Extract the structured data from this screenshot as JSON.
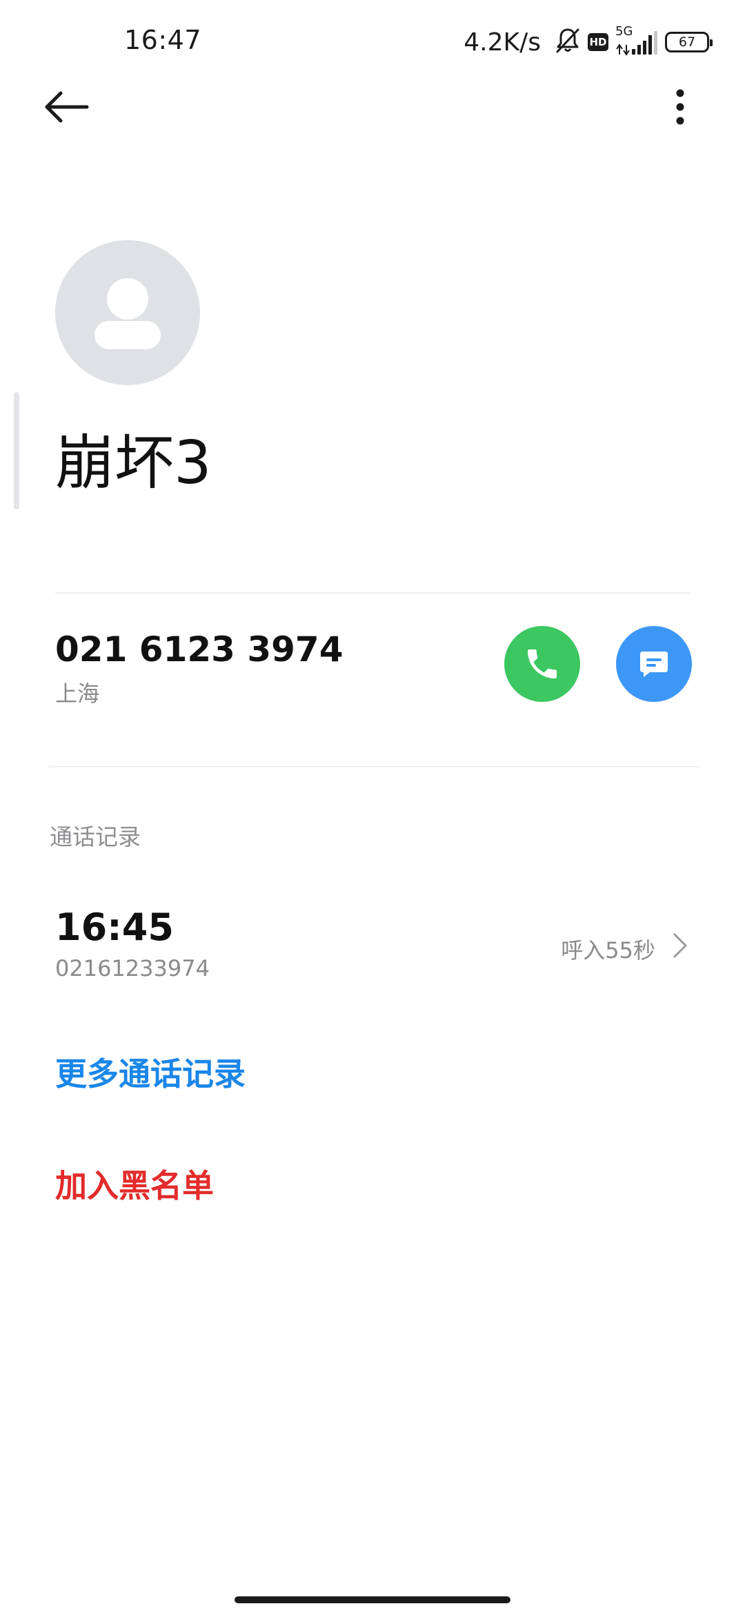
{
  "status_bar": {
    "time": "16:47",
    "net_speed": "4.2K/s",
    "hd_label": "HD",
    "network_label": "5G",
    "battery_level": "67"
  },
  "contact": {
    "name": "崩坏3",
    "phone_number": "021 6123 3974",
    "location": "上海"
  },
  "call_log": {
    "section_title": "通话记录",
    "items": [
      {
        "time": "16:45",
        "number": "02161233974",
        "info": "呼入55秒"
      }
    ]
  },
  "actions": {
    "more_records": "更多通话记录",
    "add_blacklist": "加入黑名单"
  },
  "colors": {
    "call_button": "#3cc761",
    "message_button": "#3c97f7",
    "link_blue": "#1a86e8",
    "danger_red": "#e32b2b"
  },
  "icons": {
    "back": "arrow-left-icon",
    "more": "more-vertical-icon",
    "call": "phone-icon",
    "message": "message-icon",
    "chevron": "chevron-right-icon",
    "avatar": "person-icon"
  }
}
